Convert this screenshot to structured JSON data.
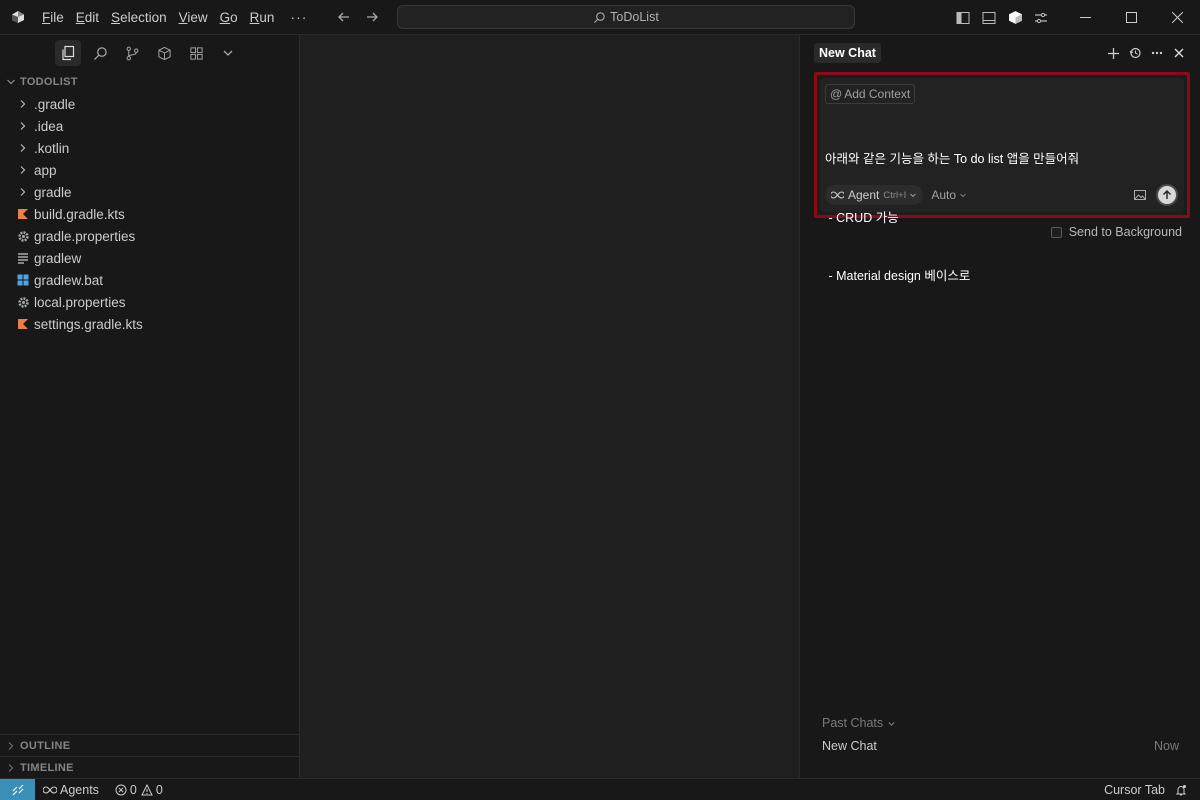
{
  "titlebar": {
    "menu": [
      "File",
      "Edit",
      "Selection",
      "View",
      "Go",
      "Run"
    ],
    "menu_underline": [
      "F",
      "E",
      "S",
      "V",
      "G",
      "R"
    ],
    "more": "···",
    "search_title": "ToDoList"
  },
  "sidebar": {
    "section_title": "TODOLIST",
    "tree": [
      {
        "label": ".gradle",
        "icon": "chevron-right-icon"
      },
      {
        "label": ".idea",
        "icon": "chevron-right-icon"
      },
      {
        "label": ".kotlin",
        "icon": "chevron-right-icon"
      },
      {
        "label": "app",
        "icon": "chevron-right-icon"
      },
      {
        "label": "gradle",
        "icon": "chevron-right-icon"
      },
      {
        "label": "build.gradle.kts",
        "icon": "kotlin-file-icon"
      },
      {
        "label": "gradle.properties",
        "icon": "gear-icon"
      },
      {
        "label": "gradlew",
        "icon": "text-lines-icon"
      },
      {
        "label": "gradlew.bat",
        "icon": "windows-icon"
      },
      {
        "label": "local.properties",
        "icon": "gear-icon"
      },
      {
        "label": "settings.gradle.kts",
        "icon": "kotlin-file-icon"
      }
    ],
    "outline": "OUTLINE",
    "timeline": "TIMELINE"
  },
  "chat": {
    "tab_label": "New Chat",
    "add_context": "Add Context",
    "prompt_lines": [
      "아래와 같은 기능을 하는 To do list 앱을 만들어줘",
      " - CRUD 가능",
      " - Material design 베이스로"
    ],
    "agent_label": "Agent",
    "agent_shortcut": "Ctrl+I",
    "model_label": "Auto",
    "send_to_background": "Send to Background",
    "past_chats_label": "Past Chats",
    "past_chats": [
      {
        "title": "New Chat",
        "time": "Now"
      }
    ]
  },
  "statusbar": {
    "agents": "Agents",
    "errors": "0",
    "warnings": "0",
    "cursor_tab": "Cursor Tab"
  },
  "colors": {
    "highlight_border": "#8b0a1a",
    "remote_bg": "#3b8eb5",
    "kotlin_icon": "#e8804a",
    "windows_icon": "#4fa3e0"
  }
}
